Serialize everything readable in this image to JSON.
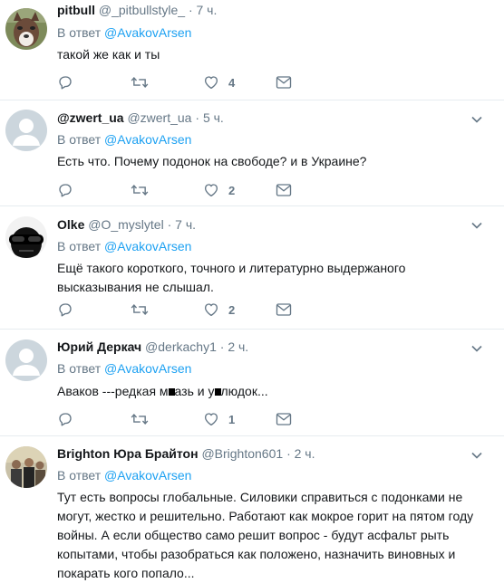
{
  "tweets": [
    {
      "name": "pitbull",
      "handle": "@_pitbullstyle_",
      "time": "7 ч.",
      "reply_prefix": "В ответ",
      "reply_to": "@AvakovArsen",
      "text": "такой же как и ты",
      "likes": "4",
      "avatar": "dog-photo"
    },
    {
      "name": "@zwert_ua",
      "handle": "@zwert_ua",
      "time": "5 ч.",
      "reply_prefix": "В ответ",
      "reply_to": "@AvakovArsen",
      "text": "Есть что. Почему подонок на свободе? и в Украине?",
      "likes": "2",
      "avatar": "default-avatar"
    },
    {
      "name": "Olke",
      "handle": "@O_myslytel",
      "time": "7 ч.",
      "reply_prefix": "В ответ",
      "reply_to": "@AvakovArsen",
      "text": "Ещё такого короткого, точного и литературно выдержаного высказывания не слышал.",
      "likes": "2",
      "avatar": "sunglasses-avatar"
    },
    {
      "name": "Юрий Деркач",
      "handle": "@derkachy1",
      "time": "2 ч.",
      "reply_prefix": "В ответ",
      "reply_to": "@AvakovArsen",
      "text_parts": [
        "Аваков  ---редкая  м",
        "азь и у",
        "людок..."
      ],
      "likes": "1",
      "avatar": "default-avatar"
    },
    {
      "name": "Brighton Юра Брайтон",
      "handle": "@Brighton601",
      "time": "2 ч.",
      "reply_prefix": "В ответ",
      "reply_to": "@AvakovArsen",
      "text": "Тут есть вопросы глобальные. Силовики справиться с подонками не могут, жестко и решительно. Работают как мокрое горит на пятом году войны. А если общество само решит вопрос - будут асфальт рыть копытами, чтобы разобраться как положено, назначить виновных и покарать кого попало...",
      "avatar": "group-photo"
    }
  ],
  "colors": {
    "link": "#1da1f2",
    "secondary": "#657786",
    "border": "#e6ecf0",
    "text": "#14171a"
  }
}
